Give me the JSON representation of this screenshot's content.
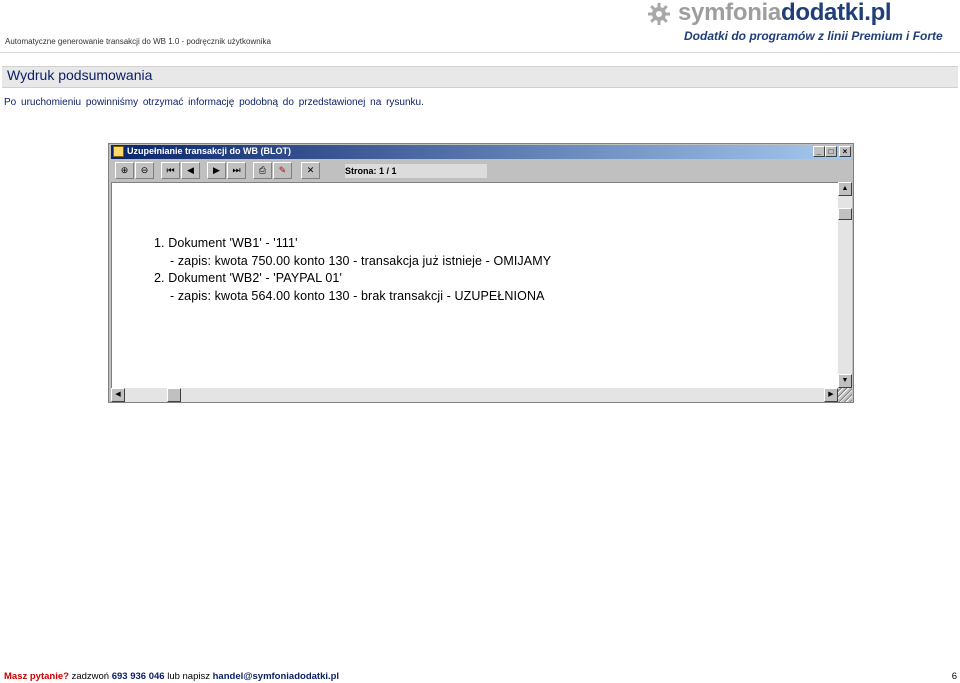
{
  "header": {
    "doc_title": "Automatyczne generowanie transakcji do WB 1.0  - podręcznik użytkownika",
    "logo_part1": "symfonia",
    "logo_part2": "dodatki.pl",
    "logo_tagline": "Dodatki do programów z linii Premium i Forte"
  },
  "section": {
    "title": "Wydruk podsumowania",
    "intro": "Po uruchomieniu powinniśmy otrzymać informację podobną do przedstawionej na rysunku."
  },
  "window": {
    "title": "Uzupełnianie transakcji do WB (BLOT)",
    "page_label": "Strona: 1 / 1",
    "lines": [
      "1. Dokument 'WB1' - '111'",
      "- zapis: kwota 750.00 konto 130 - transakcja już istnieje - OMIJAMY",
      "2. Dokument 'WB2' - 'PAYPAL 01'",
      "- zapis: kwota 564.00 konto 130 - brak transakcji - UZUPEŁNIONA"
    ]
  },
  "footer": {
    "question": "Masz pytanie?",
    "call": "zadzwoń",
    "phone": "693 936 046",
    "or_write": "lub napisz",
    "email": "handel@symfoniadodatki.pl",
    "page_number": "6"
  },
  "colors": {
    "brand_blue": "#1f3e7a",
    "brand_gray": "#9e9e9e",
    "heading_blue": "#0b1e66",
    "footer_red": "#cc0000"
  }
}
